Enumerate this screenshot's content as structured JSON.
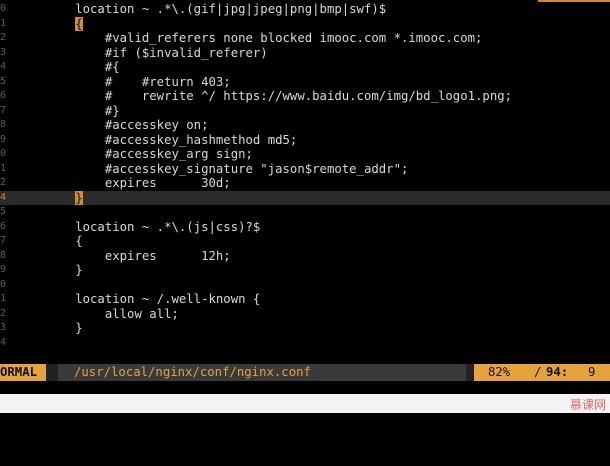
{
  "editor": {
    "lines": [
      {
        "num": "0",
        "text": "        location ~ .*\\.(gif|jpg|jpeg|png|bmp|swf)$"
      },
      {
        "num": "1",
        "text": "        ",
        "bracket": "{",
        "rest": ""
      },
      {
        "num": "2",
        "text": "            #valid_referers none blocked imooc.com *.imooc.com;"
      },
      {
        "num": "3",
        "text": "            #if ($invalid_referer)"
      },
      {
        "num": "4",
        "text": "            #{"
      },
      {
        "num": "5",
        "text": "            #    #return 403;"
      },
      {
        "num": "6",
        "text": "            #    rewrite ^/ https://www.baidu.com/img/bd_logo1.png;"
      },
      {
        "num": "7",
        "text": "            #}"
      },
      {
        "num": "8",
        "text": "            #accesskey on;"
      },
      {
        "num": "9",
        "text": "            #accesskey_hashmethod md5;"
      },
      {
        "num": "0",
        "text": "            #accesskey_arg sign;"
      },
      {
        "num": "1",
        "text": "            #accesskey_signature \"jason$remote_addr\";"
      },
      {
        "num": "2",
        "text": "            expires      30d;"
      },
      {
        "num": "4",
        "text": "        ",
        "bracket": "}",
        "rest": "",
        "current": true
      },
      {
        "num": "5",
        "text": ""
      },
      {
        "num": "6",
        "text": "        location ~ .*\\.(js|css)?$"
      },
      {
        "num": "7",
        "text": "        {"
      },
      {
        "num": "8",
        "text": "            expires      12h;"
      },
      {
        "num": "9",
        "text": "        }"
      },
      {
        "num": "0",
        "text": ""
      },
      {
        "num": "1",
        "text": "        location ~ /.well-known {"
      },
      {
        "num": "2",
        "text": "            allow all;"
      },
      {
        "num": "3",
        "text": "        }"
      },
      {
        "num": "4",
        "text": ""
      }
    ]
  },
  "statusbar": {
    "mode": "ORMAL",
    "filepath": "/usr/local/nginx/conf/nginx.conf",
    "percent": "82%",
    "separator": "/",
    "line": "94:",
    "column": "9"
  },
  "watermark": {
    "text": "慕课网"
  },
  "colors": {
    "accent": "#e6a23b",
    "cursor_bracket": "#d08a2f",
    "background": "#000000",
    "text": "#d8d8d8"
  }
}
